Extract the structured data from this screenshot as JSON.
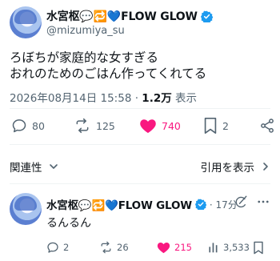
{
  "post": {
    "display_name": "水宮枢💬🔁💙FLOW GLOW",
    "handle": "@mizumiya_su",
    "text_line1": "ろぼちが家庭的な女すぎる",
    "text_line2": "おれのためのごはん作ってくれてる",
    "timestamp": "2026年08月14日 15:58 · ",
    "views_count": "1.2万",
    "views_label": " 表示",
    "replies": "80",
    "reposts": "125",
    "likes": "740",
    "bookmarks": "2"
  },
  "filter": {
    "sort_label": "関連性",
    "quote_label": "引用を表示"
  },
  "reply": {
    "display_name": "水宮枢💬🔁💙FLOW GLOW",
    "time": "· 17分",
    "text": "るんるん",
    "replies": "2",
    "reposts": "26",
    "likes": "215",
    "views": "3,533"
  },
  "colors": {
    "accent": "#1d9bf0",
    "like": "#f91880",
    "secondary_text": "#536471"
  },
  "icons": [
    "verified-badge-icon",
    "reply-icon",
    "repost-icon",
    "heart-filled-icon",
    "bookmark-icon",
    "share-icon",
    "chevron-down-icon",
    "chevron-right-icon",
    "grok-icon",
    "views-icon"
  ]
}
